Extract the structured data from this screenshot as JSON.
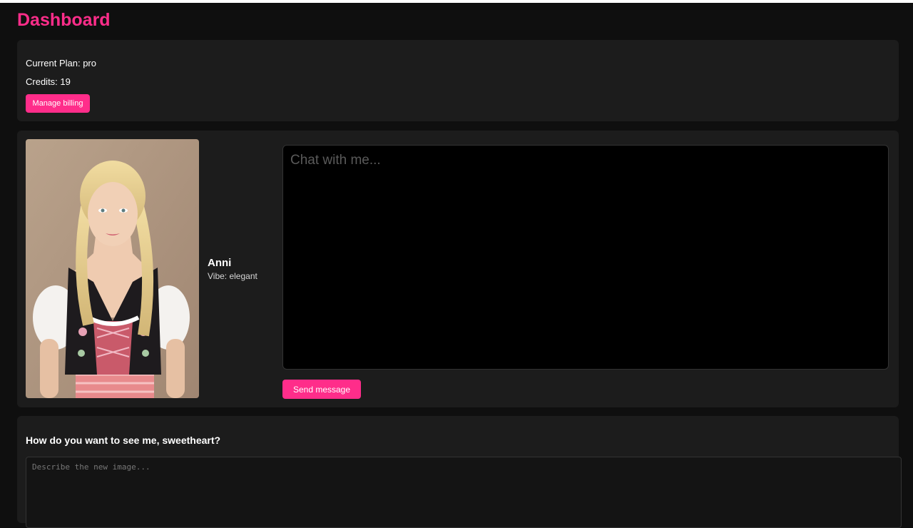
{
  "header": {
    "title": "Dashboard"
  },
  "billing": {
    "plan_text": "Current Plan: pro",
    "credits_text": "Credits: 19",
    "manage_label": "Manage billing"
  },
  "character": {
    "name": "Anni",
    "vibe_text": "Vibe: elegant",
    "portrait_icon": "portrait-photo"
  },
  "chat": {
    "placeholder": "Chat with me...",
    "send_label": "Send message"
  },
  "image_request": {
    "heading": "How do you want to see me, sweetheart?",
    "placeholder": "Describe the new image..."
  },
  "colors": {
    "accent": "#ff2d8a",
    "background": "#0f0f0f",
    "card": "#1c1c1c",
    "chat_box": "#000000"
  }
}
